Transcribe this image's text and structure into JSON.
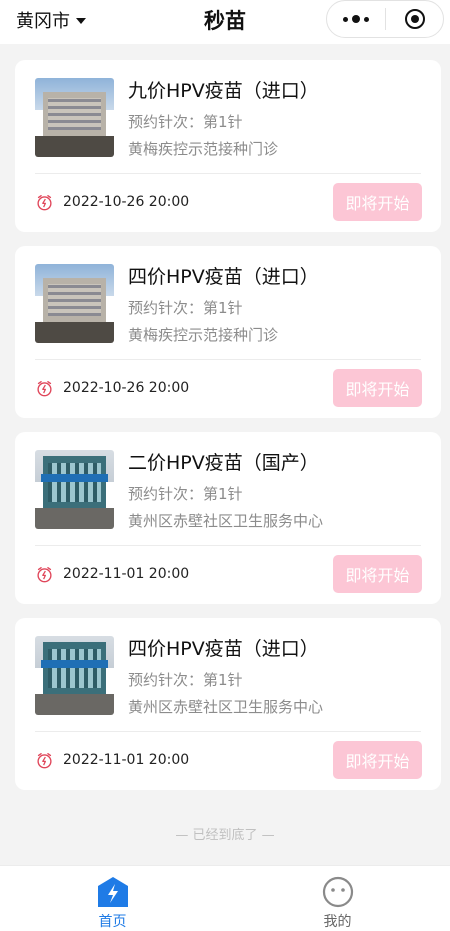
{
  "nav": {
    "city": "黄冈市",
    "title": "秒苗"
  },
  "appointments": [
    {
      "name": "九价HPV疫苗（进口）",
      "dose": "预约针次：第1针",
      "place": "黄梅疾控示范接种门诊",
      "time": "2022-10-26 20:00",
      "button": "即将开始"
    },
    {
      "name": "四价HPV疫苗（进口）",
      "dose": "预约针次：第1针",
      "place": "黄梅疾控示范接种门诊",
      "time": "2022-10-26 20:00",
      "button": "即将开始"
    },
    {
      "name": "二价HPV疫苗（国产）",
      "dose": "预约针次：第1针",
      "place": "黄州区赤壁社区卫生服务中心",
      "time": "2022-11-01 20:00",
      "button": "即将开始"
    },
    {
      "name": "四价HPV疫苗（进口）",
      "dose": "预约针次：第1针",
      "place": "黄州区赤壁社区卫生服务中心",
      "time": "2022-11-01 20:00",
      "button": "即将开始"
    }
  ],
  "end_tip": "— 已经到底了 —",
  "tabs": [
    {
      "label": "首页",
      "icon": "home-lightning-icon",
      "active": true
    },
    {
      "label": "我的",
      "icon": "profile-face-icon",
      "active": false
    }
  ],
  "colors": {
    "accent": "#1f7be6",
    "button_disabled": "#fcc6d5",
    "clock": "#e0465a"
  }
}
